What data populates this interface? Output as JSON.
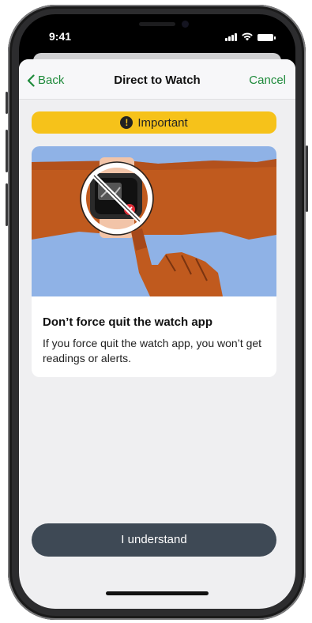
{
  "status_bar": {
    "time": "9:41"
  },
  "nav": {
    "back_label": "Back",
    "title": "Direct to Watch",
    "cancel_label": "Cancel"
  },
  "banner": {
    "icon": "exclamation-icon",
    "text": "Important"
  },
  "card": {
    "title": "Don’t force quit the watch app",
    "body": "If you force quit the watch app, you won’t get readings or alerts."
  },
  "primary_button": {
    "label": "I understand"
  },
  "colors": {
    "accent": "#1e8a3a",
    "banner": "#f6c21a",
    "button": "#3e4955",
    "sky": "#8fb2e6",
    "skin": "#c05a1e"
  }
}
